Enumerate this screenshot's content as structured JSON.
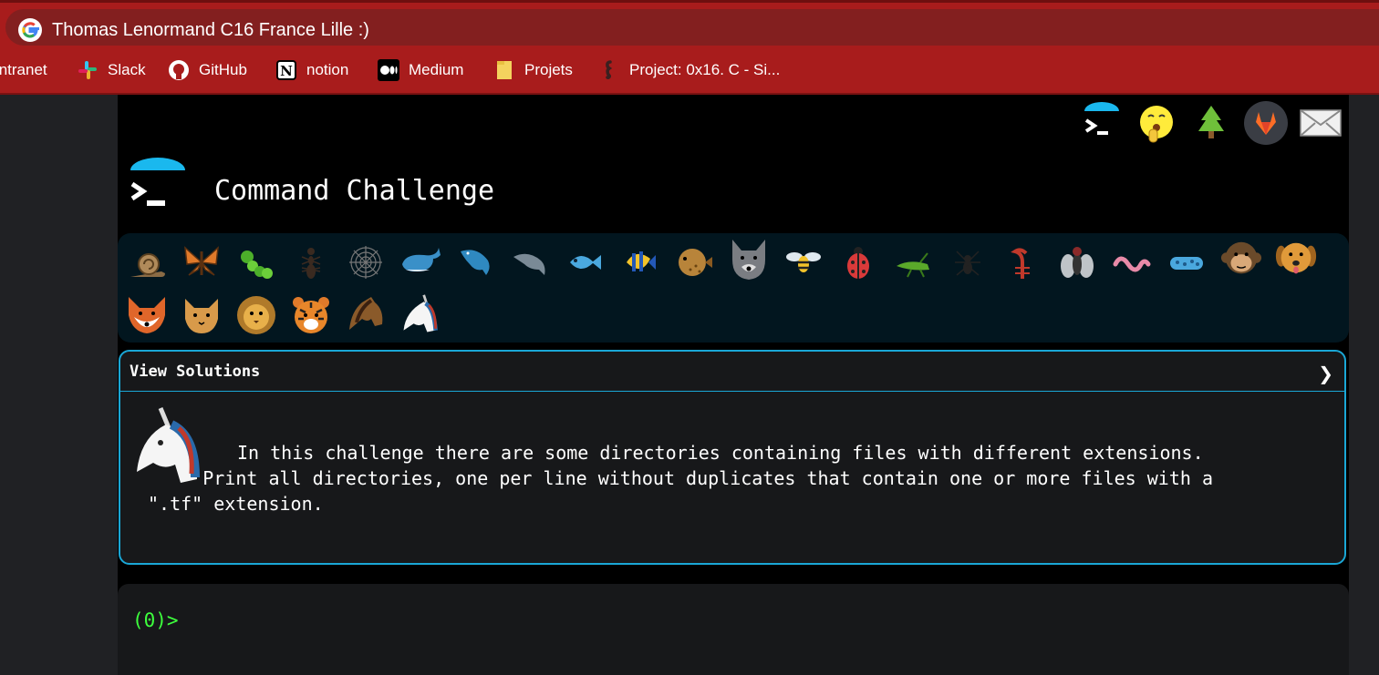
{
  "browser": {
    "tab_title": "Thomas Lenormand C16 France Lille :)",
    "bookmarks": [
      {
        "label": "Intranet",
        "icon": "intranet-icon"
      },
      {
        "label": "Slack",
        "icon": "slack-icon"
      },
      {
        "label": "GitHub",
        "icon": "github-icon"
      },
      {
        "label": "notion",
        "icon": "notion-icon"
      },
      {
        "label": "Medium",
        "icon": "medium-icon"
      },
      {
        "label": "Projets",
        "icon": "folder-icon"
      },
      {
        "label": "Project: 0x16. C - Si...",
        "icon": "seahorse-icon"
      }
    ]
  },
  "page": {
    "title": "Command Challenge",
    "top_icons": [
      "terminal-logo-icon",
      "shushing-face-icon",
      "tree-icon",
      "gitlab-icon",
      "mail-icon"
    ],
    "animals": [
      "snail",
      "butterfly",
      "caterpillar",
      "ant",
      "spider-web",
      "whale",
      "dolphin",
      "dolphin-2",
      "fish",
      "tropical-fish",
      "blowfish",
      "wolf",
      "bee",
      "ladybug",
      "cricket",
      "spider",
      "scorpion",
      "fly",
      "worm",
      "microbe",
      "monkey",
      "dog",
      "fox",
      "cat",
      "lion",
      "tiger",
      "horse",
      "unicorn"
    ],
    "solutions_label": "View Solutions",
    "chevron": "❯",
    "description": "In this challenge there are some directories containing files with different extensions.\n     Print all directories, one per line without duplicates that contain one or more files with a\n\".tf\" extension.",
    "prompt": "(0)>"
  },
  "colors": {
    "browser_bar": "#a81c1c",
    "accent": "#1aa7d6",
    "prompt": "#3dff3d"
  }
}
